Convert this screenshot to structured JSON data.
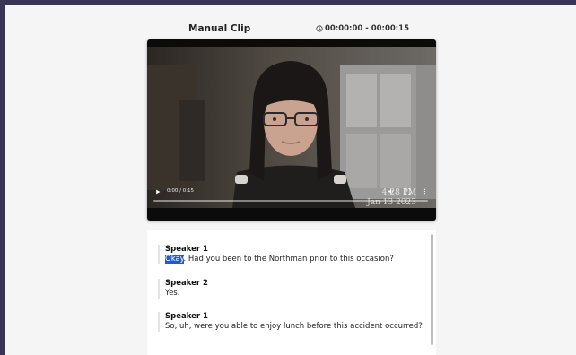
{
  "header": {
    "title": "Manual Clip",
    "time_range": "00:00:00 - 00:00:15"
  },
  "player": {
    "overlay_time": "4:28 PM",
    "overlay_date": "Jan 13 2023",
    "time_readout": "0:00 / 0:15",
    "progress": 0.0,
    "icons": [
      "play-icon",
      "volume-icon",
      "fullscreen-icon",
      "more-options-icon"
    ]
  },
  "transcript": {
    "entries": [
      {
        "speaker": "Speaker 1",
        "highlight": "Okay",
        "text": ". Had you been to the Northman prior to this occasion?"
      },
      {
        "speaker": "Speaker 2",
        "text": "Yes."
      },
      {
        "speaker": "Speaker 1",
        "text": "So, uh, were you able to enjoy lunch before this accident occurred?"
      }
    ]
  },
  "colors": {
    "frame": "#3a3556",
    "panel": "#f5f5f5",
    "highlight": "#2456d8"
  }
}
